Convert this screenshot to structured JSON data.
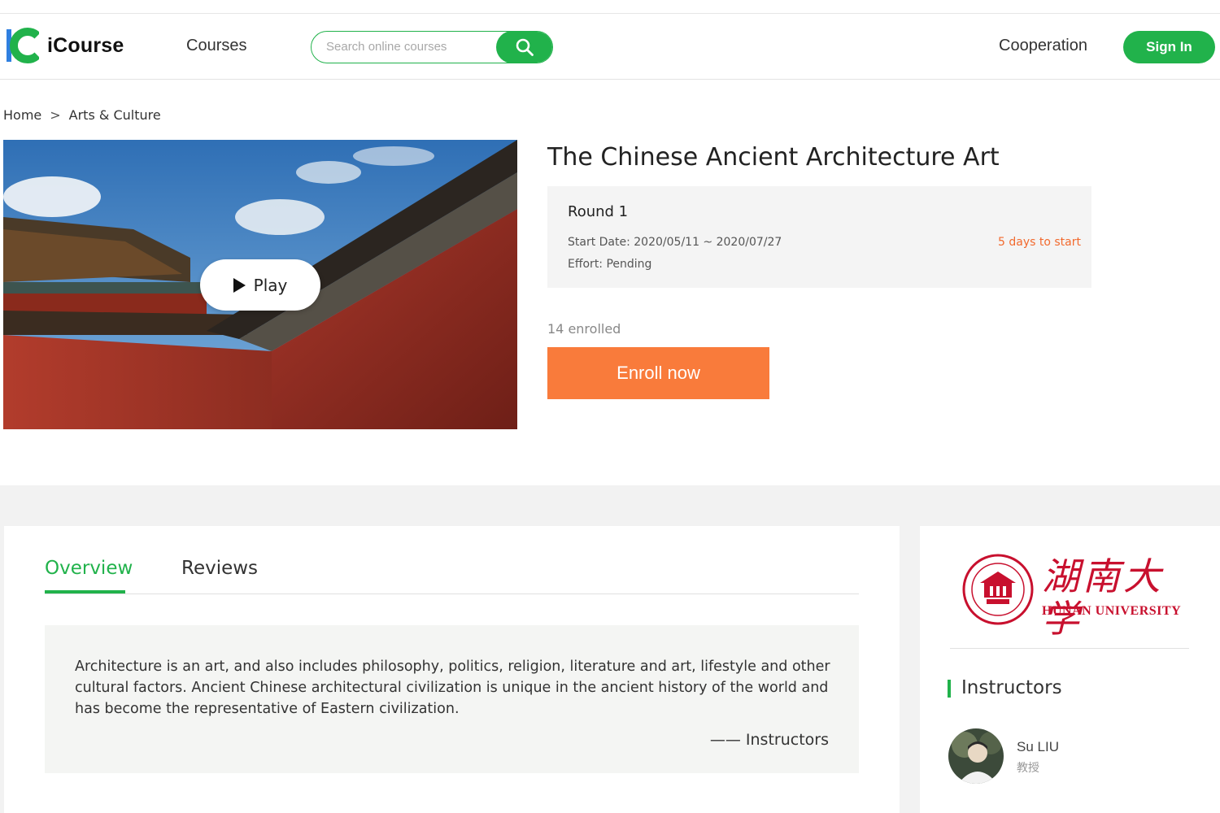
{
  "brand": {
    "name": "iCourse",
    "accent": "#21b24b",
    "logo_blue": "#2f7fe0"
  },
  "nav": {
    "courses": "Courses",
    "cooperation": "Cooperation",
    "sign_in": "Sign In"
  },
  "search": {
    "placeholder": "Search online courses",
    "icon": "search-icon"
  },
  "breadcrumb": {
    "home": "Home",
    "separator": ">",
    "category": "Arts & Culture"
  },
  "hero": {
    "play_label": "Play"
  },
  "course": {
    "title": "The Chinese Ancient Architecture Art",
    "round": "Round 1",
    "start_date": "Start Date: 2020/05/11 ~ 2020/07/27",
    "effort": "Effort: Pending",
    "days_to_start": "5 days to start",
    "enrolled": "14 enrolled",
    "enroll_button": "Enroll now",
    "status_color": "#f26a2e",
    "button_color": "#f97b3b"
  },
  "tabs": [
    {
      "label": "Overview",
      "active": true
    },
    {
      "label": "Reviews",
      "active": false
    }
  ],
  "overview": {
    "text": "Architecture is an art, and also includes philosophy, politics, religion, literature and art, lifestyle and other cultural factors. Ancient Chinese architectural civilization is unique in the ancient history of the world and has become the representative of Eastern civilization.",
    "signature": "—— Instructors"
  },
  "university": {
    "name_cn": "湖南大学",
    "name_en": "HUNAN UNIVERSITY",
    "color": "#c8102e"
  },
  "instructors": {
    "heading": "Instructors",
    "list": [
      {
        "name": "Su LIU",
        "role": "教授"
      }
    ]
  }
}
